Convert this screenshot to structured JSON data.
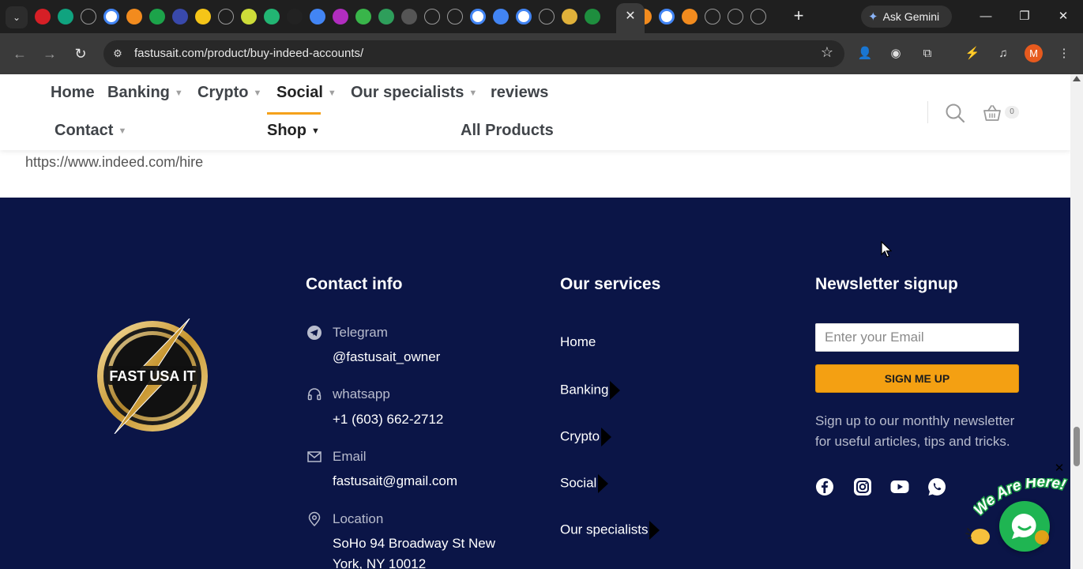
{
  "browser": {
    "tabs_favicons": [
      "youtube",
      "chatgpt",
      "perplexity",
      "google",
      "app-orange",
      "app-green",
      "app-blue-ring",
      "app-yellow-stripes",
      "perplexity",
      "app-lime",
      "app-green-v",
      "app-dark-t",
      "google-docs",
      "app-m",
      "app-green-g",
      "app-green-g2",
      "app-grid",
      "perplexity",
      "audio",
      "google",
      "google-docs",
      "google",
      "perplexity",
      "app-gold",
      "app-green-s",
      "active-tab",
      "app-orange",
      "google",
      "app-orange",
      "perplexity",
      "perplexity",
      "perplexity"
    ],
    "close_tab": "✕",
    "new_tab": "+",
    "gemini_label": "Ask Gemini",
    "window_controls": {
      "minimize": "—",
      "restore": "❐",
      "close": "✕"
    },
    "url": "fastusait.com/product/buy-indeed-accounts/",
    "profile_initial": "M"
  },
  "header": {
    "nav_row1": [
      {
        "label": "Home",
        "dropdown": false
      },
      {
        "label": "Banking",
        "dropdown": true
      },
      {
        "label": "Crypto",
        "dropdown": true
      },
      {
        "label": "Social",
        "dropdown": true
      },
      {
        "label": "Our specialists",
        "dropdown": true
      },
      {
        "label": "reviews",
        "dropdown": false
      }
    ],
    "nav_row2": [
      {
        "label": "Contact",
        "dropdown": true
      },
      {
        "label": "Shop",
        "dropdown": true
      },
      {
        "label": "All Products",
        "dropdown": false
      }
    ],
    "cart_count": "0",
    "accent_color": "#f5a11b"
  },
  "content": {
    "url_text": "https://www.indeed.com/hire"
  },
  "footer": {
    "logo_text": "FAST USA IT",
    "contact": {
      "title": "Contact info",
      "telegram_label": "Telegram",
      "telegram_value": "@fastusait_owner",
      "whatsapp_label": "whatsapp",
      "whatsapp_value": "+1 (603) 662-2712",
      "email_label": "Email",
      "email_value": "fastusait@gmail.com",
      "location_label": "Location",
      "location_value": "SoHo 94 Broadway St New York, NY 10012"
    },
    "services": {
      "title": "Our services",
      "links": [
        "Home",
        "Banking",
        "Crypto",
        "Social",
        "Our specialists"
      ]
    },
    "newsletter": {
      "title": "Newsletter signup",
      "placeholder": "Enter your Email",
      "button": "SIGN ME UP",
      "text": "Sign up to our monthly newsletter for useful articles, tips and tricks."
    },
    "social_icons": [
      "facebook-icon",
      "instagram-icon",
      "youtube-icon",
      "whatsapp-icon"
    ],
    "chat_badge_text": "We Are Here!",
    "chat_close": "✕",
    "bg_color": "#0b1547"
  }
}
